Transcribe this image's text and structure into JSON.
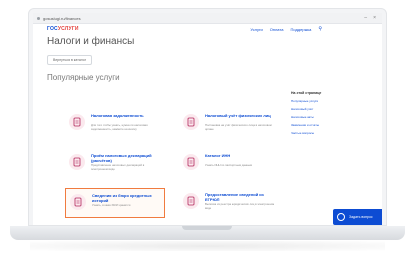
{
  "browser": {
    "url": "gosuslugi.ru/finances",
    "controls": [
      "–",
      "×"
    ]
  },
  "site": {
    "logo_main": "ГОС",
    "logo_accent": "УСЛУГИ",
    "nav": [
      "Услуги",
      "Оплата",
      "Поддержка"
    ]
  },
  "page": {
    "title": "Налоги и финансы",
    "back_label": "Вернуться в каталог",
    "section_title": "Популярные услуги"
  },
  "cards": [
    {
      "title": "Налоговая задолженность",
      "desc": "Для того чтобы узнать, нужна ли налоговая задолженность, нажмите на кнопку"
    },
    {
      "title": "Налоговый учёт физических лиц",
      "desc": "Постановка на учёт физического лица в налоговом органе"
    },
    {
      "title": "Приём налоговых деклараций (расчётов)",
      "desc": "Представление налоговых деклараций в электронном виде"
    },
    {
      "title": "Каталог ИНН",
      "desc": "Узнать ИНН по паспортным данным"
    },
    {
      "title": "Сведения из бюро кредитных историй",
      "desc": "Узнать, в каких БКИ хранится"
    },
    {
      "title": "Предоставление сведений из ЕГРЮЛ",
      "desc": "Выписка из реестра юридических лиц в электронном виде"
    }
  ],
  "side": {
    "title": "На этой странице",
    "links": [
      "Популярные услуги",
      "Налоговый учёт",
      "Налоговые акты",
      "Заявления и отчёты",
      "Частые вопросы"
    ]
  },
  "help": {
    "label": "Задать вопрос"
  },
  "colors": {
    "brand_blue": "#0d4cd3",
    "brand_red": "#e4403b",
    "highlight": "#f07b3f",
    "icon_bg": "#fbe9ee"
  }
}
